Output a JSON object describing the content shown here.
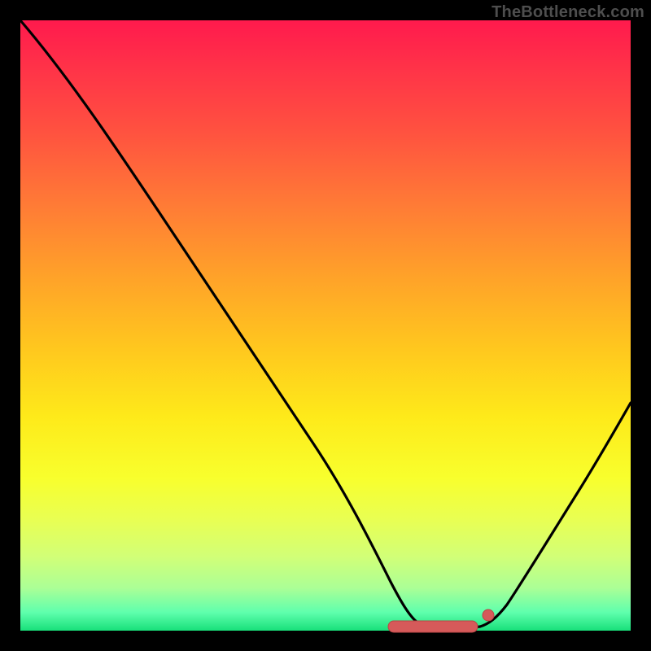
{
  "attribution": "TheBottleneck.com",
  "colors": {
    "frame": "#000000",
    "curve": "#000000",
    "marker_fill": "#d65a5a",
    "marker_stroke": "#b94646",
    "gradient_top": "#ff1a4d",
    "gradient_bottom": "#18e07a"
  },
  "chart_data": {
    "type": "line",
    "title": "",
    "xlabel": "",
    "ylabel": "",
    "xlim": [
      0,
      100
    ],
    "ylim": [
      0,
      100
    ],
    "grid": false,
    "legend": false,
    "series": [
      {
        "name": "bottleneck-curve",
        "x": [
          0,
          5,
          10,
          15,
          20,
          25,
          30,
          35,
          40,
          45,
          50,
          55,
          58,
          60,
          62,
          65,
          68,
          70,
          73,
          75,
          78,
          82,
          86,
          90,
          94,
          100
        ],
        "values": [
          100,
          92,
          84,
          76,
          68,
          60,
          52,
          44,
          36,
          28,
          20,
          12,
          7,
          4,
          2.5,
          1.2,
          1,
          1,
          1.3,
          2,
          4,
          9,
          16,
          23,
          30,
          42
        ]
      }
    ],
    "annotations": [
      {
        "name": "flat-minimum",
        "shape": "pill",
        "x_start": 60,
        "x_end": 73,
        "y": 1
      },
      {
        "name": "minimum-end-dot",
        "shape": "dot",
        "x": 75.5,
        "y": 2.5
      }
    ]
  }
}
